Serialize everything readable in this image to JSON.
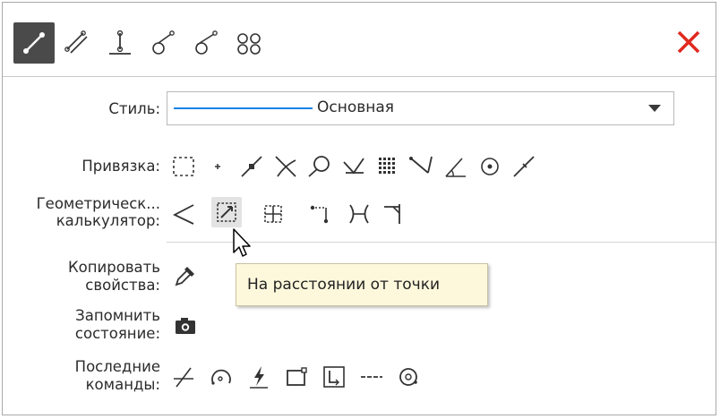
{
  "toolbar": {
    "buttons": [
      {
        "icon": "segment-two-points-icon",
        "active": true
      },
      {
        "icon": "parallel-segment-icon",
        "active": false
      },
      {
        "icon": "perpendicular-segment-icon",
        "active": false
      },
      {
        "icon": "tangent-segment-icon",
        "active": false
      },
      {
        "icon": "tangent-two-curves-icon",
        "active": false
      },
      {
        "icon": "segment-two-circles-icon",
        "active": false
      }
    ],
    "close_icon": "close-icon",
    "close_color": "#e0291f"
  },
  "style": {
    "label": "Стиль:",
    "value": "Основная",
    "line_color": "#1a84e8"
  },
  "snap": {
    "label": "Привязка:",
    "icons": [
      "frame-snap-icon",
      "point-snap-icon",
      "midpoint-snap-icon",
      "intersection-snap-icon",
      "tangent-snap-icon",
      "normal-snap-icon",
      "grid-snap-icon",
      "angle-snap-icon",
      "angle-measure-snap-icon",
      "center-snap-icon",
      "on-curve-snap-icon"
    ]
  },
  "geometric_calculator": {
    "label_line1": "Геометрическ...",
    "label_line2": "калькулятор:",
    "icons": [
      "angle-calc-icon",
      "distance-from-point-icon",
      "frame-calc-icon",
      "point-offset-icon",
      "bracket-calc-icon",
      "perpendicular-calc-icon"
    ],
    "hovered_index": 1
  },
  "copy_properties": {
    "label_line1": "Копировать",
    "label_line2": "свойства:",
    "icon": "eyedropper-icon"
  },
  "remember_state": {
    "label_line1": "Запомнить",
    "label_line2": "состояние:",
    "icon": "camera-icon"
  },
  "recent_commands": {
    "label_line1": "Последние",
    "label_line2": "команды:",
    "icons": [
      "trim-command-icon",
      "arc-command-icon",
      "lightning-command-icon",
      "rectangle-command-icon",
      "dimension-command-icon",
      "dashed-line-command-icon",
      "circle-command-icon"
    ]
  },
  "tooltip": {
    "text": "На расстоянии от точки"
  }
}
